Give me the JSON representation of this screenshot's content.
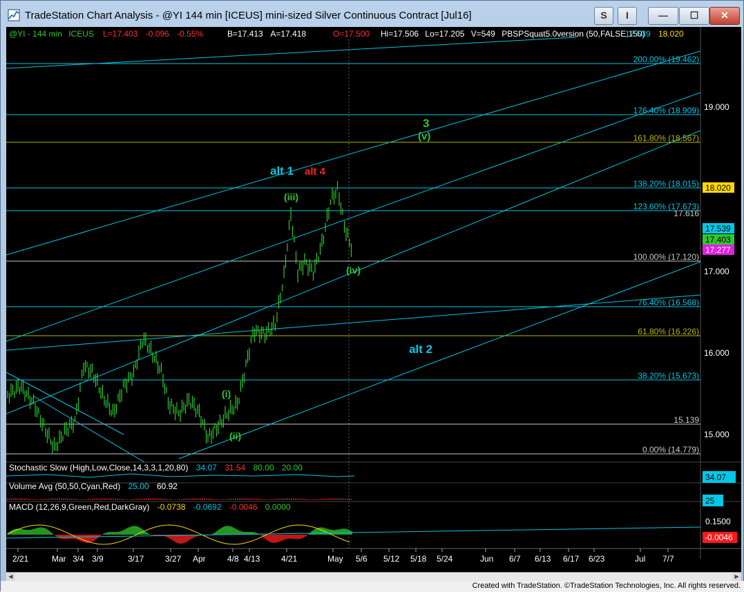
{
  "window": {
    "title": "TradeStation Chart Analysis - @YI 144 min [ICEUS] mini-sized Silver Continuous Contract [Jul16]",
    "btn_s": "S",
    "btn_i": "I",
    "btn_min": "—",
    "btn_max": "☐",
    "btn_close": "✕"
  },
  "header": {
    "symbol": "@YI - 144 min",
    "exchange": "ICEUS",
    "last": "L=17.403",
    "change": "-0.096",
    "change_pct": "-0.55%",
    "bid": "B=17.413",
    "ask": "A=17.418",
    "open": "O=17.500",
    "high": "Hi=17.506",
    "low": "Lo=17.205",
    "volume": "V=549",
    "indicator": "PBSPSquat5.0version (50,FALSE,150)",
    "ind_v1": "17.539",
    "ind_v2": "18.020"
  },
  "price_axis": [
    "19.000",
    "17.000",
    "16.000",
    "15.000"
  ],
  "price_tags": [
    {
      "label": "18.020",
      "color": "#ffd800",
      "text": "#000000"
    },
    {
      "label": "17.539",
      "color": "#00c8e8",
      "text": "#000000"
    },
    {
      "label": "17.403",
      "color": "#2ec82e",
      "text": "#000000"
    },
    {
      "label": "17.277",
      "color": "#e020e0",
      "text": "#ffffff"
    }
  ],
  "fib_levels": [
    {
      "label": "200.00% (19.462)",
      "color": "#00c8e8"
    },
    {
      "label": "176.40% (18.909)",
      "color": "#00c8e8"
    },
    {
      "label": "161.80% (18.567)",
      "color": "#b8b800"
    },
    {
      "label": "138.20% (18.015)",
      "color": "#00c8e8"
    },
    {
      "label": "123.60% (17.673)",
      "color": "#00c8e8"
    },
    {
      "label": "17.616",
      "color": "#c8c8c8"
    },
    {
      "label": "100.00% (17.120)",
      "color": "#c8c8c8"
    },
    {
      "label": "76.40% (16.568)",
      "color": "#00c8e8"
    },
    {
      "label": "61.80% (16.226)",
      "color": "#b8b800"
    },
    {
      "label": "38.20% (15.673)",
      "color": "#00c8e8"
    },
    {
      "label": "15.139",
      "color": "#c8c8c8"
    },
    {
      "label": "0.00% (14.779)",
      "color": "#c8c8c8"
    }
  ],
  "wave_labels": {
    "alt1": "alt 1",
    "alt4": "alt 4",
    "three": "3",
    "v": "(v)",
    "iii": "(iii)",
    "iv": "(iv)",
    "i": "(i)",
    "ii": "(ii)",
    "alt2": "alt 2"
  },
  "stochastic": {
    "name": "Stochastic Slow (High,Low,Close,14,3,3,1,20,80)",
    "v1": "34.07",
    "v2": "31.54",
    "v3": "80.00",
    "v4": "20.00",
    "tag": "34.07"
  },
  "volume_avg": {
    "name": "Volume Avg (50,50,Cyan,Red)",
    "v1": "25.00",
    "v2": "60.92",
    "tag": "25"
  },
  "macd": {
    "name": "MACD (12,26,9,Green,Red,DarkGray)",
    "v1": "-0.0738",
    "v2": "-0.0692",
    "v3": "-0.0046",
    "v4": "0.0000",
    "axis": "0.1500",
    "tag": "-0.0046"
  },
  "time_axis": [
    "2/21",
    "Mar",
    "3/4",
    "3/9",
    "3/17",
    "3/27",
    "Apr",
    "4/8",
    "4/13",
    "4/21",
    "May",
    "5/6",
    "5/12",
    "5/18",
    "5/24",
    "Jun",
    "6/7",
    "6/13",
    "6/17",
    "6/23",
    "Jul",
    "7/7"
  ],
  "credit": "Created with TradeStation. ©TradeStation Technologies, Inc. All rights reserved."
}
